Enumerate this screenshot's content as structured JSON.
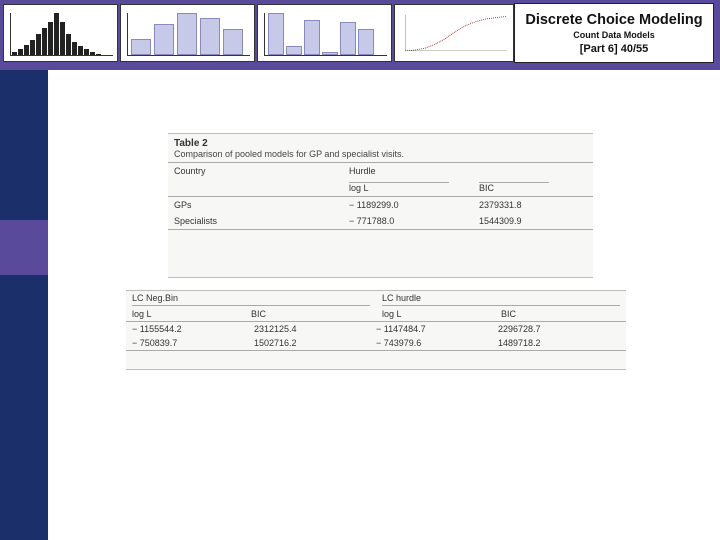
{
  "header": {
    "title": "Discrete Choice Modeling",
    "subtitle": "Count Data Models",
    "part": "[Part 6]  40/55"
  },
  "chart_data": [
    {
      "type": "bar",
      "title": "",
      "values": [
        2,
        4,
        7,
        10,
        14,
        18,
        22,
        28,
        22,
        14,
        9,
        6,
        4,
        2,
        1
      ]
    },
    {
      "type": "bar",
      "title": "",
      "values": [
        18,
        35,
        48,
        42,
        30
      ]
    },
    {
      "type": "bar",
      "title": "",
      "values": [
        48,
        10,
        40,
        4,
        38,
        30
      ]
    },
    {
      "type": "line",
      "title": "",
      "x": [
        0,
        1,
        2,
        3,
        4,
        5,
        6,
        7,
        8,
        9,
        10
      ],
      "values": [
        0,
        2,
        6,
        14,
        26,
        40,
        52,
        60,
        65,
        68,
        70
      ]
    }
  ],
  "table1": {
    "label": "Table 2",
    "caption": "Comparison of pooled models for GP and specialist visits.",
    "col_country": "Country",
    "col_group": "Hurdle",
    "sub1": "log L",
    "sub2": "BIC",
    "rows": [
      {
        "name": "GPs",
        "logL": "− 1189299.0",
        "bic": "2379331.8"
      },
      {
        "name": "Specialists",
        "logL": "− 771788.0",
        "bic": "1544309.9"
      }
    ]
  },
  "table2": {
    "sec1_label": "LC Neg.Bin",
    "sec2_label": "LC hurdle",
    "sub_logL": "log L",
    "sub_bic": "BIC",
    "rows": [
      {
        "a": "− 1155544.2",
        "b": "2312125.4",
        "c": "− 1147484.7",
        "d": "2296728.7"
      },
      {
        "a": "− 750839.7",
        "b": "1502716.2",
        "c": "− 743979.6",
        "d": "1489718.2"
      }
    ]
  }
}
